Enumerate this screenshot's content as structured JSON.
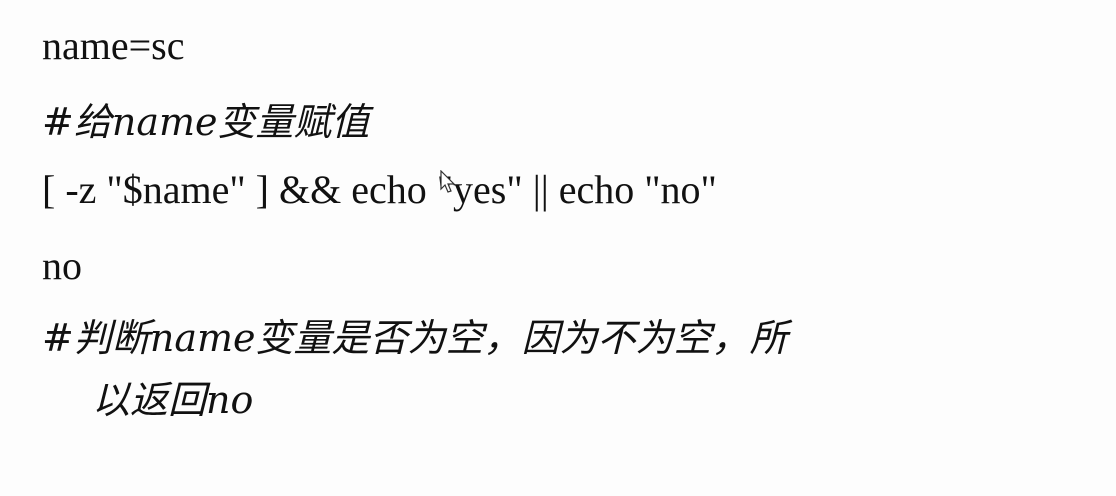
{
  "lines": {
    "assign": "name=sc",
    "assign_comment": "#给name变量赋值",
    "test_cmd": "[ -z \"$name\" ] && echo \"yes\" || echo \"no\"",
    "output": "no",
    "test_comment_line1": "#判断name变量是否为空，因为不为空，所",
    "test_comment_line2": "以返回no"
  },
  "icons": {
    "cursor": "mouse-pointer-icon"
  }
}
